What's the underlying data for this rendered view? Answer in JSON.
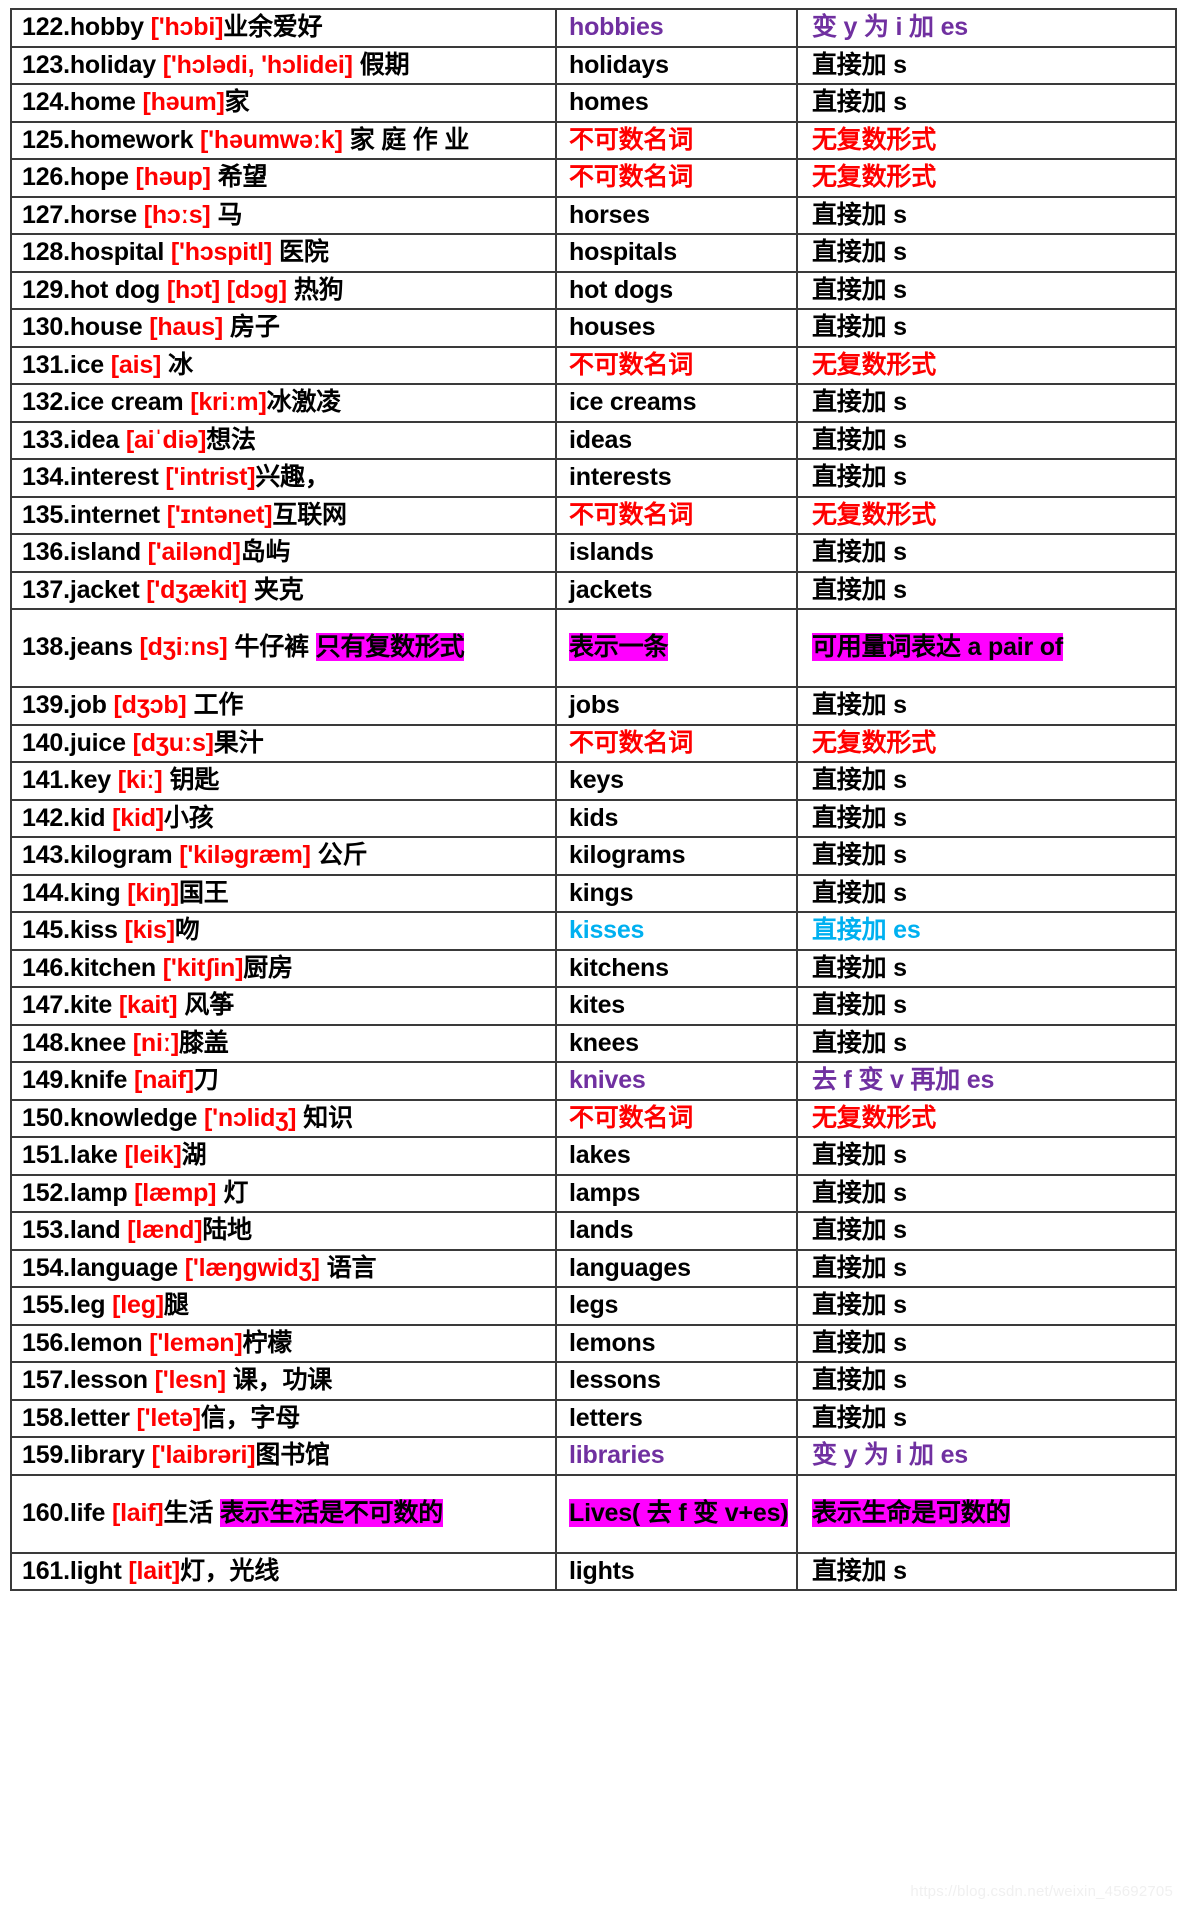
{
  "document": {
    "type": "vocabulary-plural-forms-table",
    "watermark": "https://blog.csdn.net/weixin_45692705",
    "colors": {
      "ipa_red": "#ff0000",
      "purple": "#7030a0",
      "cyan": "#00b0f0",
      "highlight_magenta": "#ff00ff",
      "black": "#000000",
      "border": "#3a3a3a"
    },
    "columns": [
      "word_entry",
      "plural_form",
      "rule"
    ]
  },
  "rows": [
    {
      "num": "122.",
      "word": "hobby",
      "ipa": "['hɔbi]",
      "cn": "业余爱好",
      "cn_space_before": false,
      "plural": "hobbies",
      "plural_color": "purple",
      "rule": "变 y 为 i 加  es",
      "rule_color": "purple"
    },
    {
      "num": "123.",
      "word": "holiday",
      "ipa": "['hɔlədi, 'hɔlidei]",
      "cn": "假期",
      "cn_space_before": true,
      "plural": "holidays",
      "plural_color": "black",
      "rule": "直接加  s",
      "rule_color": "black"
    },
    {
      "num": "124.",
      "word": "home",
      "ipa": "[həum]",
      "cn": "家",
      "cn_space_before": false,
      "plural": "homes",
      "plural_color": "black",
      "rule": "直接加  s",
      "rule_color": "black"
    },
    {
      "num": "125.",
      "word": "homework",
      "ipa": "['həumwəːk]",
      "cn": "家 庭 作 业",
      "cn_space_before": true,
      "plural": "不可数名词",
      "plural_color": "red",
      "rule": "无复数形式",
      "rule_color": "red"
    },
    {
      "num": "126.",
      "word": "hope",
      "ipa": "[həup]",
      "cn": "希望",
      "cn_space_before": true,
      "plural": "不可数名词",
      "plural_color": "red",
      "rule": "无复数形式",
      "rule_color": "red"
    },
    {
      "num": "127.",
      "word": "horse",
      "ipa": "[hɔːs]",
      "cn": "马",
      "cn_space_before": true,
      "plural": "horses",
      "plural_color": "black",
      "rule": "直接加  s",
      "rule_color": "black"
    },
    {
      "num": "128.",
      "word": "hospital",
      "ipa": "['hɔspitl]",
      "cn": "医院",
      "cn_space_before": true,
      "plural": "hospitals",
      "plural_color": "black",
      "rule": "直接加  s",
      "rule_color": "black"
    },
    {
      "num": "129.",
      "word": "hot dog",
      "ipa": "[hɔt] [dɔg]",
      "cn": "热狗",
      "cn_space_before": true,
      "plural": "hot dogs",
      "plural_color": "black",
      "rule": "直接加  s",
      "rule_color": "black"
    },
    {
      "num": "130.",
      "word": "house",
      "ipa": "[haus]",
      "cn": "房子",
      "cn_space_before": true,
      "plural": "houses",
      "plural_color": "black",
      "rule": "直接加  s",
      "rule_color": "black"
    },
    {
      "num": "131.",
      "word": "ice",
      "ipa": "[ais]",
      "cn": "冰",
      "cn_space_before": true,
      "plural": "不可数名词",
      "plural_color": "red",
      "rule": "无复数形式",
      "rule_color": "red"
    },
    {
      "num": "132.",
      "word": "ice cream",
      "ipa": "[kriːm]",
      "cn": "冰激凌",
      "cn_space_before": false,
      "plural": "ice creams",
      "plural_color": "black",
      "rule": "直接加  s",
      "rule_color": "black"
    },
    {
      "num": "133.",
      "word": "idea",
      "ipa": "[aiˈdiə]",
      "cn": "想法",
      "cn_space_before": false,
      "plural": "ideas",
      "plural_color": "black",
      "rule": "直接加  s",
      "rule_color": "black"
    },
    {
      "num": "134.",
      "word": "interest",
      "ipa": "['intrist]",
      "cn": "兴趣，",
      "cn_space_before": false,
      "plural": "interests",
      "plural_color": "black",
      "rule": "直接加  s",
      "rule_color": "black"
    },
    {
      "num": "135.",
      "word": "internet",
      "ipa": "['ɪntənet]",
      "cn": "互联网",
      "cn_space_before": false,
      "plural": "不可数名词",
      "plural_color": "red",
      "rule": "无复数形式",
      "rule_color": "red"
    },
    {
      "num": "136.",
      "word": "island",
      "ipa": "['ailənd]",
      "cn": "岛屿",
      "cn_space_before": false,
      "plural": "islands",
      "plural_color": "black",
      "rule": "直接加  s",
      "rule_color": "black"
    },
    {
      "num": "137.",
      "word": "jacket",
      "ipa": "['dʒækit]",
      "cn": "夹克",
      "cn_space_before": true,
      "plural": "jackets",
      "plural_color": "black",
      "rule": "直接加  s",
      "rule_color": "black"
    },
    {
      "num": "138.",
      "word": "jeans",
      "ipa": "[dʒiːns]",
      "cn": "牛仔裤",
      "cn_space_before": true,
      "cn_extra_hl": "只有复数形式",
      "plural": "表示一条",
      "plural_color": "black",
      "plural_highlight": true,
      "rule": "可用量词表达  a pair of",
      "rule_color": "black",
      "rule_highlight": true,
      "tall": true
    },
    {
      "num": "139.",
      "word": "job",
      "ipa": "[dʒɔb]",
      "cn": "工作",
      "cn_space_before": true,
      "plural": "jobs",
      "plural_color": "black",
      "rule": "直接加  s",
      "rule_color": "black"
    },
    {
      "num": "140.",
      "word": "juice",
      "ipa": "[dʒuːs]",
      "cn": "果汁",
      "cn_space_before": false,
      "plural": "不可数名词",
      "plural_color": "red",
      "rule": "无复数形式",
      "rule_color": "red"
    },
    {
      "num": "141.",
      "word": "key",
      "ipa": "[kiː]",
      "cn": "钥匙",
      "cn_space_before": true,
      "plural": "keys",
      "plural_color": "black",
      "rule": "直接加  s",
      "rule_color": "black"
    },
    {
      "num": "142.",
      "word": "kid",
      "ipa": "[kid]",
      "cn": "小孩",
      "cn_space_before": false,
      "plural": "kids",
      "plural_color": "black",
      "rule": "直接加  s",
      "rule_color": "black"
    },
    {
      "num": "143.",
      "word": "kilogram",
      "ipa": "['kiləgræm]",
      "cn": "公斤",
      "cn_space_before": true,
      "plural": "kilograms",
      "plural_color": "black",
      "rule": "直接加  s",
      "rule_color": "black"
    },
    {
      "num": "144.",
      "word": "king",
      "ipa": "[kiŋ]",
      "cn": "国王",
      "cn_space_before": false,
      "plural": "kings",
      "plural_color": "black",
      "rule": "直接加  s",
      "rule_color": "black"
    },
    {
      "num": "145.",
      "word": "kiss",
      "ipa": "[kis]",
      "cn": "吻",
      "cn_space_before": false,
      "plural": "kisses",
      "plural_color": "cyan",
      "rule": "直接加  es",
      "rule_color": "cyan"
    },
    {
      "num": "146.",
      "word": "kitchen",
      "ipa": "['kitʃin]",
      "cn": "厨房",
      "cn_space_before": false,
      "plural": "kitchens",
      "plural_color": "black",
      "rule": "直接加  s",
      "rule_color": "black"
    },
    {
      "num": "147.",
      "word": "kite",
      "ipa": "[kait]",
      "cn": "风筝",
      "cn_space_before": true,
      "plural": "kites",
      "plural_color": "black",
      "rule": "直接加  s",
      "rule_color": "black"
    },
    {
      "num": "148.",
      "word": "knee",
      "ipa": "[niː]",
      "cn": "膝盖",
      "cn_space_before": false,
      "plural": "knees",
      "plural_color": "black",
      "rule": "直接加  s",
      "rule_color": "black"
    },
    {
      "num": "149.",
      "word": "knife",
      "ipa": "[naif]",
      "cn": "刀",
      "cn_space_before": false,
      "plural": "knives",
      "plural_color": "purple",
      "rule": "去 f 变 v 再加 es",
      "rule_color": "purple"
    },
    {
      "num": "150.",
      "word": "knowledge",
      "ipa": "['nɔlidʒ]",
      "cn": "知识",
      "cn_space_before": true,
      "plural": "不可数名词",
      "plural_color": "red",
      "rule": "无复数形式",
      "rule_color": "red"
    },
    {
      "num": "151.",
      "word": "lake",
      "ipa": "[leik]",
      "cn": "湖",
      "cn_space_before": false,
      "plural": "lakes",
      "plural_color": "black",
      "rule": "直接加  s",
      "rule_color": "black"
    },
    {
      "num": "152.",
      "word": "lamp",
      "ipa": "[læmp]",
      "cn": "灯",
      "cn_space_before": true,
      "plural": "lamps",
      "plural_color": "black",
      "rule": "直接加  s",
      "rule_color": "black"
    },
    {
      "num": "153.",
      "word": "land",
      "ipa": "[lænd]",
      "cn": "陆地",
      "cn_space_before": false,
      "plural": "lands",
      "plural_color": "black",
      "rule": "直接加  s",
      "rule_color": "black"
    },
    {
      "num": "154.",
      "word": "language",
      "ipa": "['læŋgwidʒ]",
      "cn": "语言",
      "cn_space_before": true,
      "plural": "languages",
      "plural_color": "black",
      "rule": "直接加  s",
      "rule_color": "black"
    },
    {
      "num": "155.",
      "word": "leg",
      "ipa": "[leg]",
      "cn": "腿",
      "cn_space_before": false,
      "plural": "legs",
      "plural_color": "black",
      "rule": "直接加  s",
      "rule_color": "black"
    },
    {
      "num": "156.",
      "word": "lemon",
      "ipa": "['lemən]",
      "cn": "柠檬",
      "cn_space_before": false,
      "plural": "lemons",
      "plural_color": "black",
      "rule": "直接加  s",
      "rule_color": "black"
    },
    {
      "num": "157.",
      "word": "lesson",
      "ipa": "['lesn]",
      "cn": "课，功课",
      "cn_space_before": true,
      "plural": "lessons",
      "plural_color": "black",
      "rule": "直接加  s",
      "rule_color": "black"
    },
    {
      "num": "158.",
      "word": "letter",
      "ipa": "['letə]",
      "cn": "信，字母",
      "cn_space_before": false,
      "plural": "letters",
      "plural_color": "black",
      "rule": "直接加  s",
      "rule_color": "black"
    },
    {
      "num": "159.",
      "word": "library",
      "ipa": "['laibrəri]",
      "cn": "图书馆",
      "cn_space_before": false,
      "plural": "libraries",
      "plural_color": "purple",
      "rule": "变 y 为 i 加  es",
      "rule_color": "purple"
    },
    {
      "num": "160.",
      "word": "life",
      "ipa": "[laif]",
      "cn": "生活",
      "cn_space_before": false,
      "cn_extra_hl": "表示生活是不可数的",
      "plural": "Lives( 去  f  变 v+es)",
      "plural_color": "black",
      "plural_highlight": true,
      "rule": "表示生命是可数的",
      "rule_color": "black",
      "rule_highlight": true,
      "tall": true
    },
    {
      "num": "161.",
      "word": "light",
      "ipa": "[lait]",
      "cn": "灯，光线",
      "cn_space_before": false,
      "plural": "lights",
      "plural_color": "black",
      "rule": "直接加  s",
      "rule_color": "black"
    }
  ]
}
